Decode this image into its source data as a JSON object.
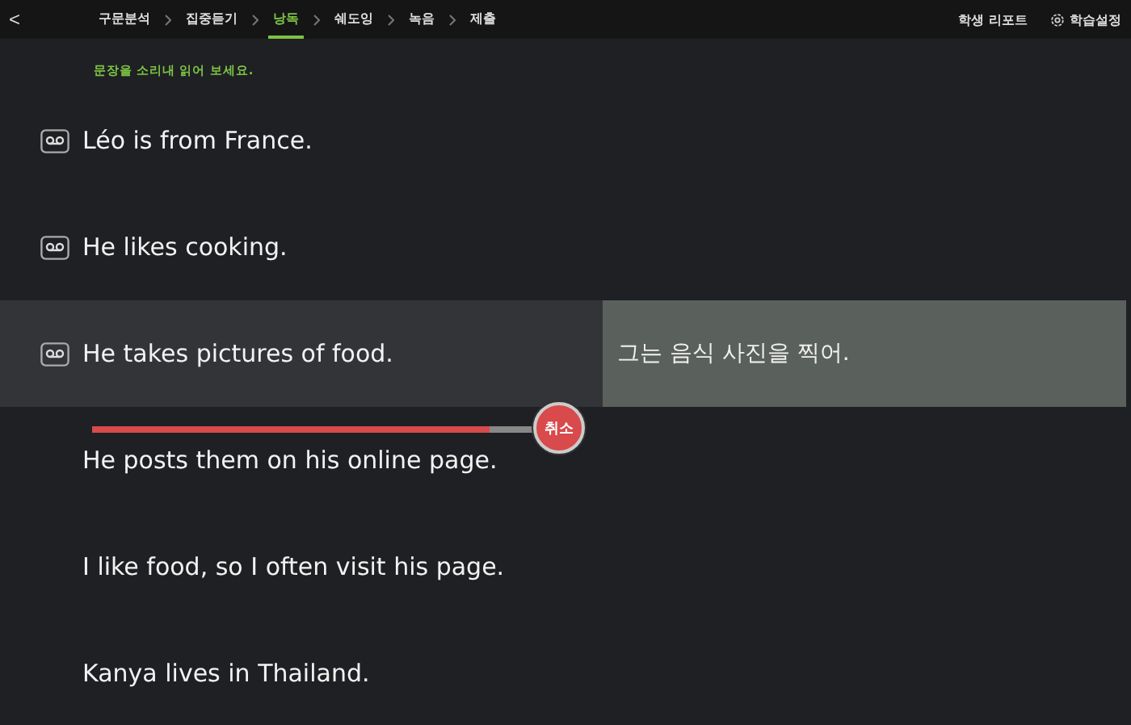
{
  "nav": {
    "back": "<",
    "steps": [
      {
        "label": "구문분석",
        "selected": false
      },
      {
        "label": "집중듣기",
        "selected": false
      },
      {
        "label": "낭독",
        "selected": true
      },
      {
        "label": "쉐도잉",
        "selected": false
      },
      {
        "label": "녹음",
        "selected": false
      },
      {
        "label": "제출",
        "selected": false
      }
    ],
    "report": "학생 리포트",
    "settings": "학습설정"
  },
  "instruction": "문장을 소리내 읽어 보세요.",
  "sentences": [
    {
      "text": "Léo is from France.",
      "recorded": true,
      "selected": false
    },
    {
      "text": "He likes cooking.",
      "recorded": true,
      "selected": false
    },
    {
      "text": "He takes pictures of food.",
      "recorded": true,
      "selected": true,
      "translation": "그는 음식 사진을 찍어.",
      "playback": {
        "level": 0.9,
        "cancel": "취소"
      }
    },
    {
      "text": "He posts them on his online page.",
      "recorded": false,
      "selected": false
    },
    {
      "text": "I like food, so I often visit his page.",
      "recorded": false,
      "selected": false
    },
    {
      "text": "Kanya lives in Thailand.",
      "recorded": false,
      "selected": false
    }
  ]
}
